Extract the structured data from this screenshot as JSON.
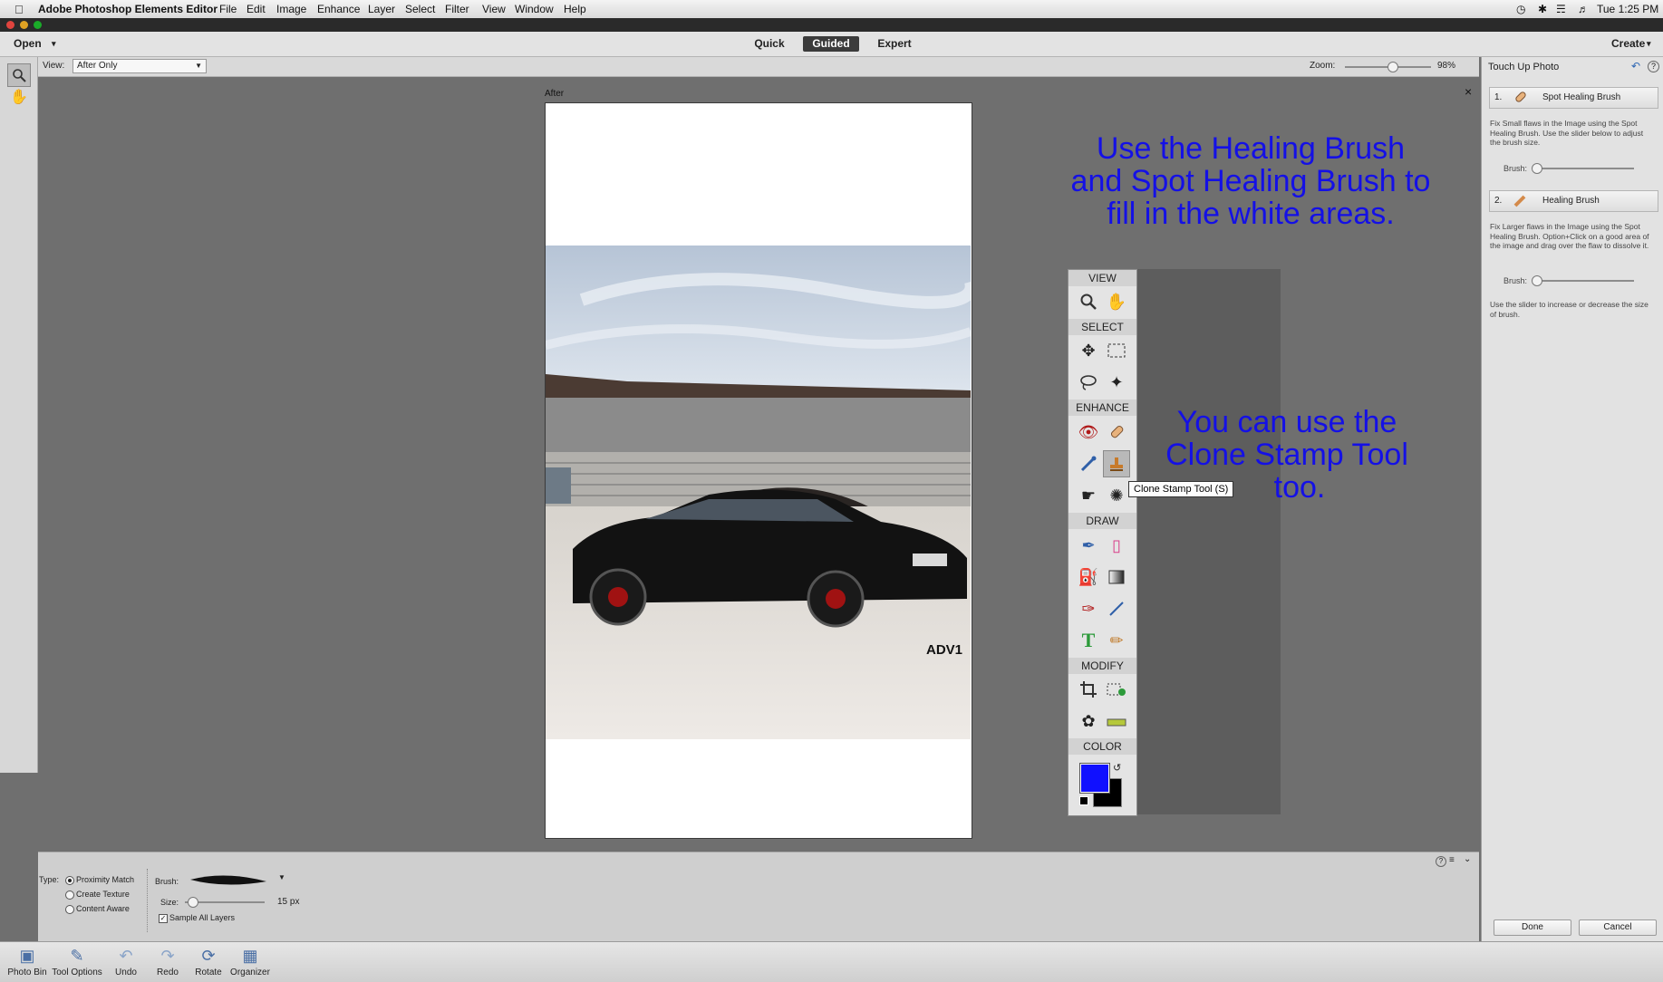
{
  "app_menu": {
    "apple": "",
    "app_name": "Adobe Photoshop Elements Editor",
    "items": [
      "File",
      "Edit",
      "Image",
      "Enhance",
      "Layer",
      "Select",
      "Filter",
      "View",
      "Window",
      "Help"
    ],
    "clock": "Tue 1:25 PM"
  },
  "modebar": {
    "open": "Open",
    "modes": [
      "Quick",
      "Guided",
      "Expert"
    ],
    "active_mode": "Guided",
    "create": "Create"
  },
  "viewbar": {
    "view_label": "View:",
    "view_value": "After Only",
    "zoom_label": "Zoom:",
    "zoom_value": "98%",
    "zoom_level": 0.55
  },
  "canvas": {
    "after_label": "After",
    "close": "×",
    "watermark": "ADV1"
  },
  "annotations": {
    "top": [
      "Use the Healing Brush",
      "and Spot Healing Brush to",
      "fill in the white areas."
    ],
    "middle": [
      "You can use the",
      "Clone Stamp Tool",
      "too."
    ]
  },
  "toolbox": {
    "sections": [
      "VIEW",
      "SELECT",
      "ENHANCE",
      "DRAW",
      "MODIFY",
      "COLOR"
    ],
    "tooltip": "Clone Stamp Tool (S)",
    "foreground_color": "#1010ff",
    "background_color": "#000000"
  },
  "right_panel": {
    "title": "Touch Up Photo",
    "step1_num": "1.",
    "step1_label": "Spot Healing Brush",
    "step1_desc": "Fix Small flaws in the Image using the Spot Healing Brush. Use the slider below to adjust the brush size.",
    "brush_label": "Brush:",
    "step2_num": "2.",
    "step2_label": "Healing Brush",
    "step2_desc": "Fix Larger flaws in the Image using the Spot Healing Brush. Option+Click on a good area of the image and drag over the flaw to dissolve it.",
    "step2_hint": "Use the slider to increase or decrease the size of brush.",
    "done": "Done",
    "cancel": "Cancel"
  },
  "tool_options": {
    "type_label": "Type:",
    "types": [
      "Proximity Match",
      "Create Texture",
      "Content Aware"
    ],
    "selected_type": "Proximity Match",
    "brush_label": "Brush:",
    "size_label": "Size:",
    "size_value": "15 px",
    "sample_all": "Sample All Layers",
    "sample_all_checked": true
  },
  "taskbar": [
    "Photo Bin",
    "Tool Options",
    "Undo",
    "Redo",
    "Rotate",
    "Organizer"
  ]
}
